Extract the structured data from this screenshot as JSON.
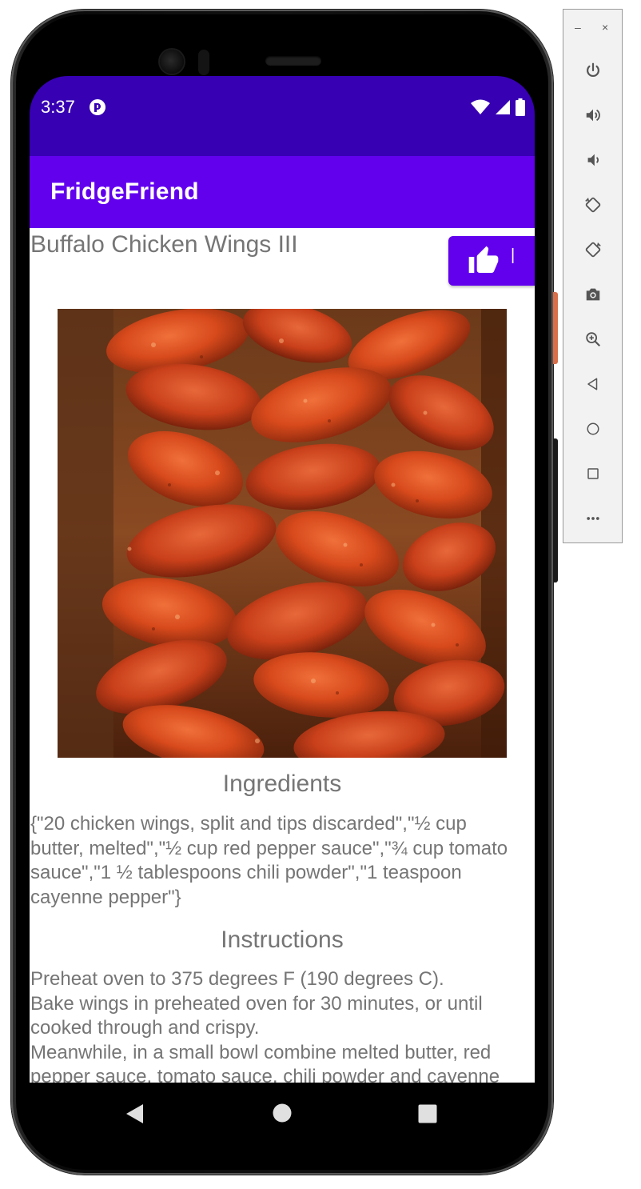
{
  "status_bar": {
    "time": "3:37",
    "app_icon": "app-notification-icon",
    "icons": [
      "wifi-icon",
      "signal-icon",
      "battery-icon"
    ]
  },
  "app_bar": {
    "title": "FridgeFriend",
    "color": "#6200ee",
    "status_color": "#3700b3"
  },
  "recipe": {
    "title": "Buffalo Chicken Wings III",
    "like_button_icon": "thumbs-up-icon",
    "like_count": "|",
    "photo": "buffalo-wings-photo",
    "ingredients_heading": "Ingredients",
    "ingredients_lines": [
      "{\"20 chicken wings, split and tips discarded\",\"½ cup",
      "butter, melted\",\"½ cup red pepper sauce\",\"¾ cup tomato",
      "sauce\",\"1 ½ tablespoons chili powder\",\"1 teaspoon",
      "cayenne pepper\"}"
    ],
    "instructions_heading": "Instructions",
    "instructions_lines": [
      "Preheat oven to 375 degrees F (190 degrees C).",
      "Bake wings in preheated oven for 30 minutes, or until",
      "cooked through and crispy.",
      "Meanwhile, in a small bowl combine melted butter, red",
      "pepper sauce, tomato sauce, chili powder and cayenne"
    ]
  },
  "nav_bar": {
    "buttons": [
      "back-triangle-icon",
      "home-circle-icon",
      "recents-square-icon"
    ]
  },
  "emulator_panel": {
    "minimize_label": "–",
    "close_label": "×",
    "buttons": [
      "power-icon",
      "volume-up-icon",
      "volume-down-icon",
      "rotate-left-icon",
      "rotate-right-icon",
      "camera-icon",
      "zoom-icon",
      "back-icon",
      "home-icon",
      "overview-icon",
      "more-icon"
    ]
  }
}
